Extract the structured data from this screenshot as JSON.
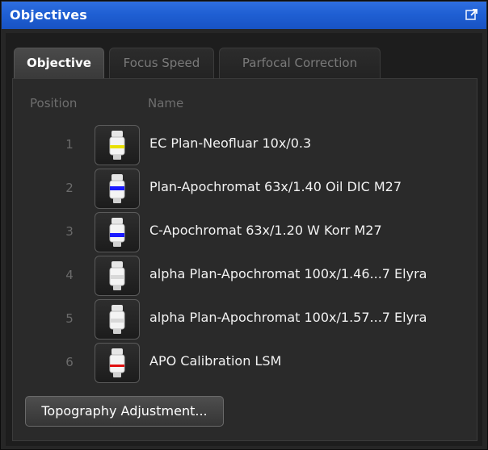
{
  "window": {
    "title": "Objectives",
    "undock_icon": "undock-icon"
  },
  "tabs": [
    {
      "label": "Objective",
      "active": true
    },
    {
      "label": "Focus Speed",
      "active": false
    },
    {
      "label": "Parfocal Correction",
      "active": false
    }
  ],
  "table": {
    "headers": {
      "position": "Position",
      "name": "Name"
    },
    "rows": [
      {
        "position": "1",
        "name": "EC Plan-Neofluar 10x/0.3",
        "band_color": "#e8e000"
      },
      {
        "position": "2",
        "name": "Plan-Apochromat 63x/1.40 Oil DIC M27",
        "band_color": "#1a1aff"
      },
      {
        "position": "3",
        "name": "C-Apochromat 63x/1.20 W Korr M27",
        "band_color": "#1a1aff"
      },
      {
        "position": "4",
        "name": "alpha Plan-Apochromat 100x/1.46...7 Elyra",
        "band_color": "#d8d8d8"
      },
      {
        "position": "5",
        "name": "alpha Plan-Apochromat 100x/1.57...7 Elyra",
        "band_color": "#d8d8d8"
      },
      {
        "position": "6",
        "name": "APO Calibration LSM",
        "band_color": "#e01010"
      }
    ]
  },
  "buttons": {
    "topography": "Topography Adjustment..."
  },
  "colors": {
    "titlebar": "#1f5fd3",
    "panel_bg": "#2a2a2a",
    "text": "#f2f2f2"
  }
}
